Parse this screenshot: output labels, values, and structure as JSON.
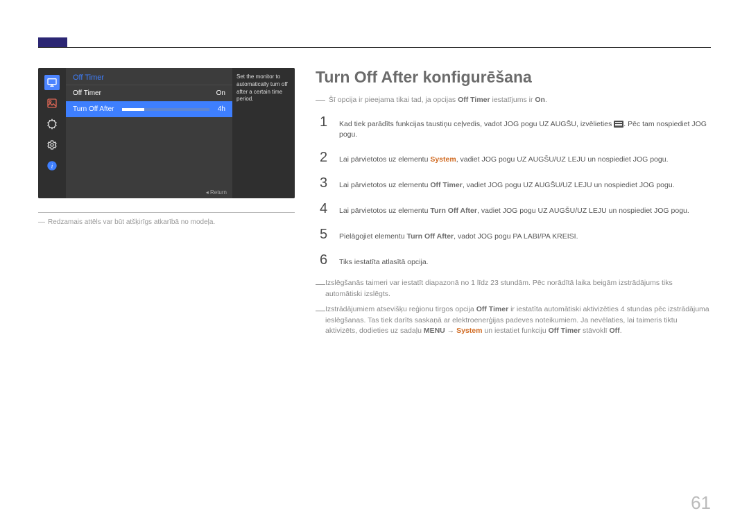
{
  "page_number": "61",
  "osd": {
    "title": "Off Timer",
    "row1_label": "Off Timer",
    "row1_value": "On",
    "row2_label": "Turn Off After",
    "row2_value": "4h",
    "description": "Set the monitor to automatically turn off after a certain time period.",
    "return_label": "Return"
  },
  "left_note": "Redzamais attēls var būt atšķirīgs atkarībā no modeļa.",
  "content": {
    "heading": "Turn Off After konfigurēšana",
    "sub_a": "Šī opcija ir pieejama tikai tad, ja opcijas ",
    "sub_b": "Off Timer",
    "sub_c": " iestatījums ir ",
    "sub_d": "On",
    "sub_e": ".",
    "s1a": "Kad tiek parādīts funkcijas taustiņu ceļvedis, vadot JOG pogu UZ AUGŠU, izvēlieties ",
    "s1b": ". Pēc tam nospiediet JOG pogu.",
    "s2a": "Lai pārvietotos uz elementu ",
    "s2b": "System",
    "s2c": ", vadiet JOG pogu UZ AUGŠU/UZ LEJU un nospiediet JOG pogu.",
    "s3a": "Lai pārvietotos uz elementu ",
    "s3b": "Off Timer",
    "s3c": ", vadiet JOG pogu UZ AUGŠU/UZ LEJU un nospiediet JOG pogu.",
    "s4a": "Lai pārvietotos uz elementu ",
    "s4b": "Turn Off After",
    "s4c": ", vadiet JOG pogu UZ AUGŠU/UZ LEJU un nospiediet JOG pogu.",
    "s5a": "Pielāgojiet elementu ",
    "s5b": "Turn Off After",
    "s5c": ", vadot JOG pogu PA LABI/PA KREISI.",
    "s6": "Tiks iestatīta atlasītā opcija.",
    "fn1": "Izslēgšanās taimeri var iestatīt diapazonā no 1 līdz 23 stundām. Pēc norādītā laika beigām izstrādājums tiks automātiski izslēgts.",
    "fn2a": "Izstrādājumiem atsevišķu reģionu tirgos opcija ",
    "fn2b": "Off Timer",
    "fn2c": " ir iestatīta automātiski aktivizēties 4 stundas pēc izstrādājuma ieslēgšanas. Tas tiek darīts saskaņā ar elektroenerģijas padeves noteikumiem. Ja nevēlaties, lai taimeris tiktu aktivizēts, dodieties uz sadaļu ",
    "fn2d": "MENU",
    "fn2e": " → ",
    "fn2f": "System",
    "fn2g": " un iestatiet funkciju ",
    "fn2h": "Off Timer",
    "fn2i": " stāvoklī ",
    "fn2j": "Off",
    "fn2k": "."
  }
}
